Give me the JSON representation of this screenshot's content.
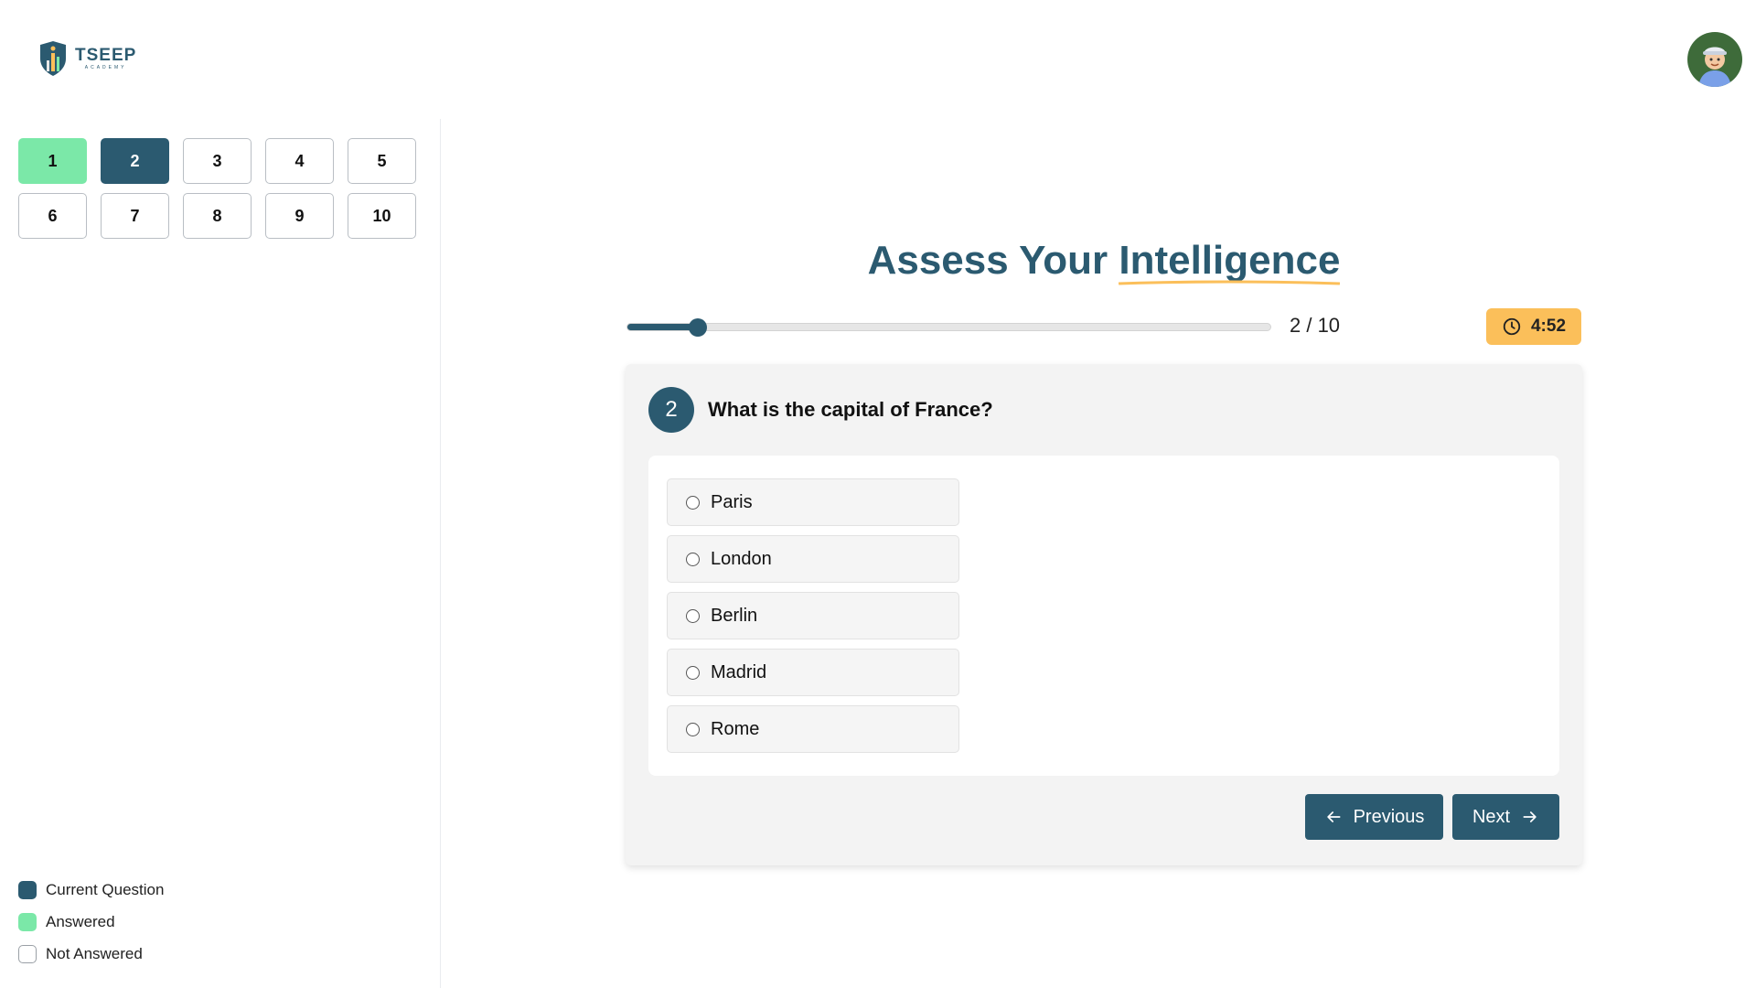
{
  "brand": {
    "name": "TSEEP",
    "tagline": "ACADEMY",
    "colors": {
      "primary": "#2b5a70",
      "answered": "#7be8a8",
      "timer": "#fbbf5a",
      "accent_underline": "#fbbf5a"
    }
  },
  "header": {
    "avatar_icon": "user-avatar-icon"
  },
  "question_nav": {
    "items": [
      {
        "label": "1",
        "state": "answered"
      },
      {
        "label": "2",
        "state": "current"
      },
      {
        "label": "3",
        "state": "not-answered"
      },
      {
        "label": "4",
        "state": "not-answered"
      },
      {
        "label": "5",
        "state": "not-answered"
      },
      {
        "label": "6",
        "state": "not-answered"
      },
      {
        "label": "7",
        "state": "not-answered"
      },
      {
        "label": "8",
        "state": "not-answered"
      },
      {
        "label": "9",
        "state": "not-answered"
      },
      {
        "label": "10",
        "state": "not-answered"
      }
    ]
  },
  "legend": {
    "current": "Current Question",
    "answered": "Answered",
    "not_answered": "Not Answered"
  },
  "main": {
    "title_prefix": "Assess Your",
    "title_highlight": "Intelligence",
    "progress": {
      "current": 2,
      "total": 10,
      "text": "2 / 10",
      "fraction": 0.11
    },
    "timer": {
      "value": "4:52",
      "icon": "clock-icon"
    }
  },
  "question": {
    "number": "2",
    "text": "What is the capital of France?",
    "options": [
      "Paris",
      "London",
      "Berlin",
      "Madrid",
      "Rome"
    ]
  },
  "navigation": {
    "previous_label": "Previous",
    "next_label": "Next",
    "previous_icon": "arrow-left-icon",
    "next_icon": "arrow-right-icon"
  }
}
